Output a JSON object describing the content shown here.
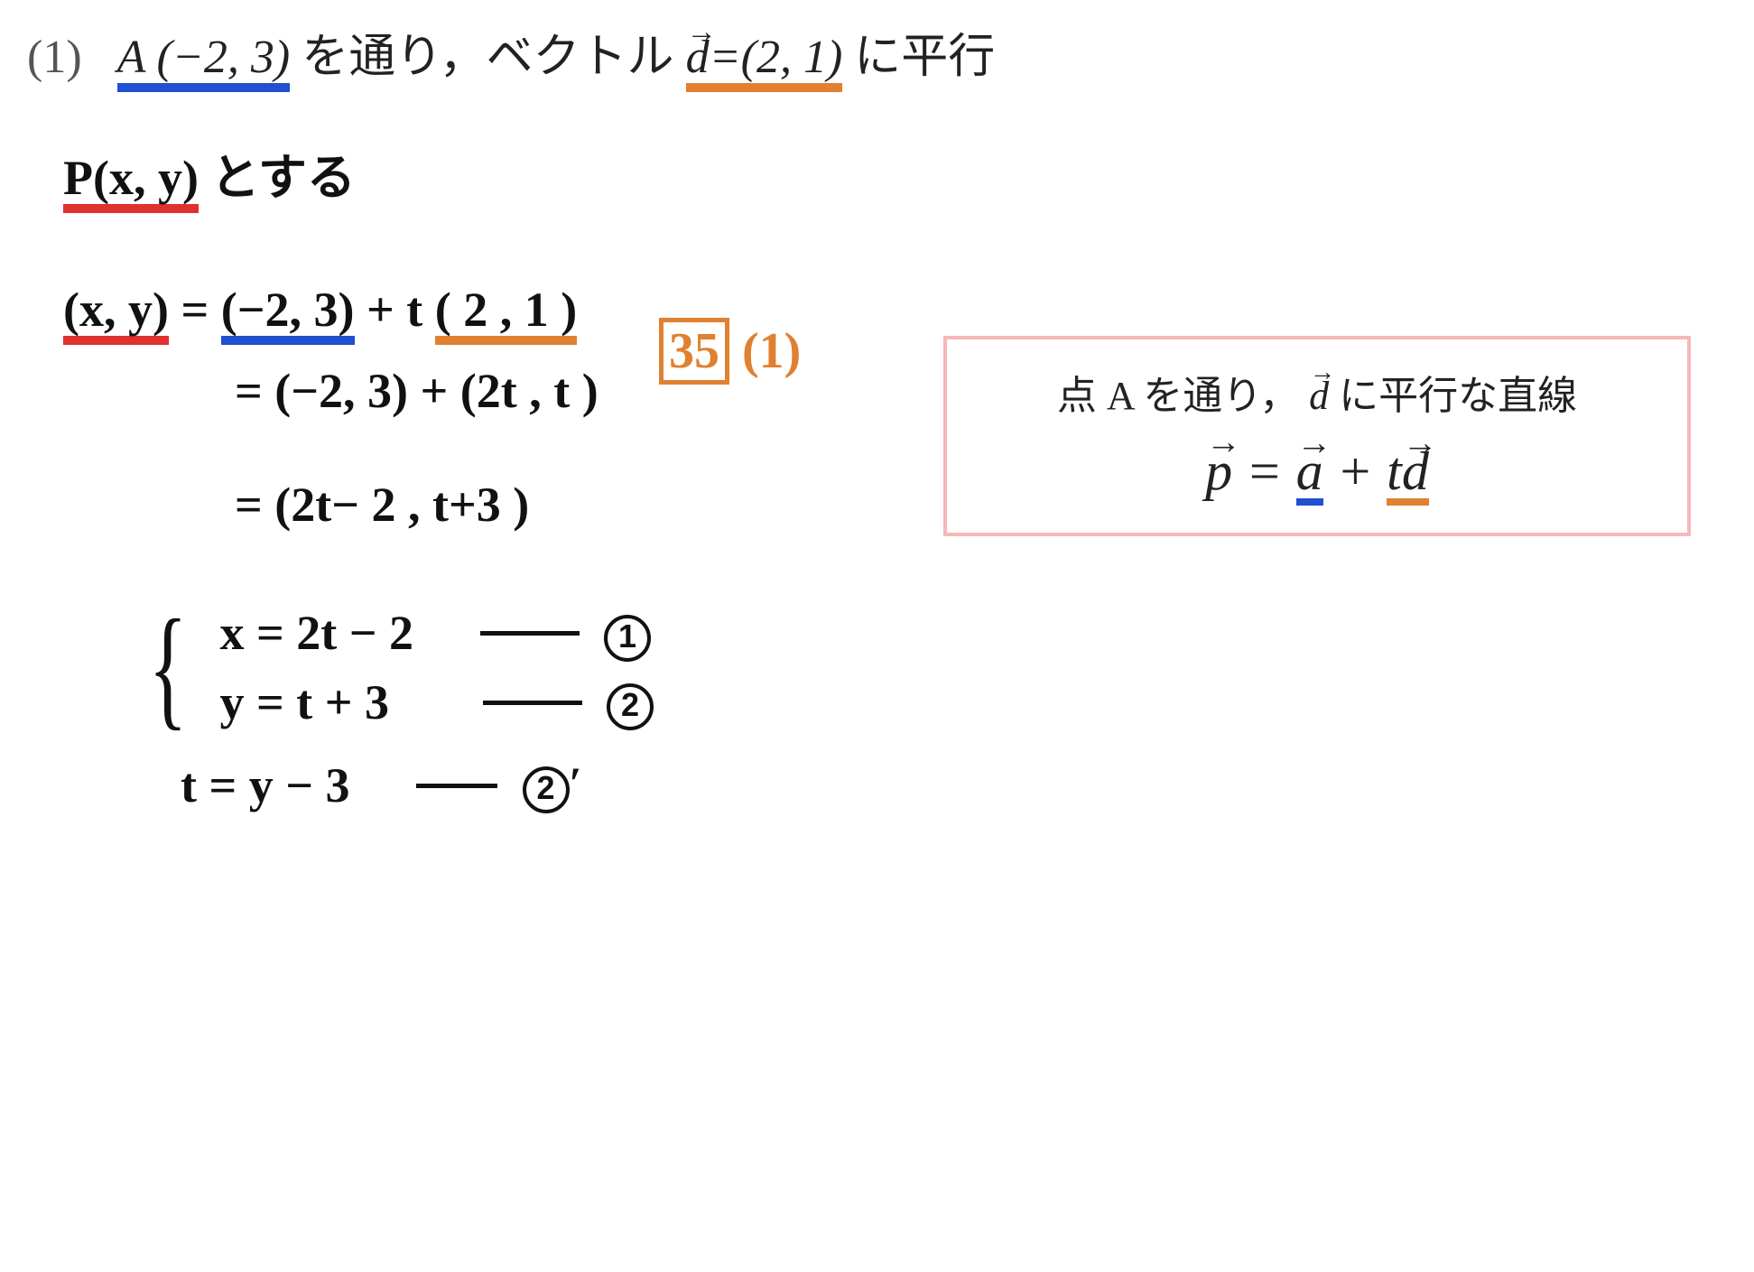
{
  "problem": {
    "number": "(1)",
    "point_label": "A (−2,  3)",
    "mid1": " を通り，ベクトル ",
    "vector_label": "d",
    "vector_value": "=(2,  1)",
    "tail": " に平行"
  },
  "work": {
    "line1_a": "P(x, y)",
    "line1_b": " とする",
    "ref_box": "35",
    "ref_sub": "(1)",
    "line2_a": "(x, y)",
    "line2_eq": " = ",
    "line2_b": "(−2, 3)",
    "line2_plus": " + t ",
    "line2_c": "( 2 , 1 )",
    "line3": "=  (−2, 3) + (2t , t )",
    "line4": "=  (2t− 2 ,  t+3 )",
    "sys1": "x = 2t − 2",
    "sys2": "y = t + 3",
    "circ1": "1",
    "circ2": "2",
    "line7": "t = y − 3",
    "circ2p": "2",
    "prime": "′"
  },
  "box": {
    "text1": "点 A を通り，",
    "vec": "d",
    "text2": " に平行な直線",
    "eq_p": "p",
    "eq_eq": " = ",
    "eq_a": "a",
    "eq_plus": " + ",
    "eq_t": "t",
    "eq_d": "d"
  }
}
